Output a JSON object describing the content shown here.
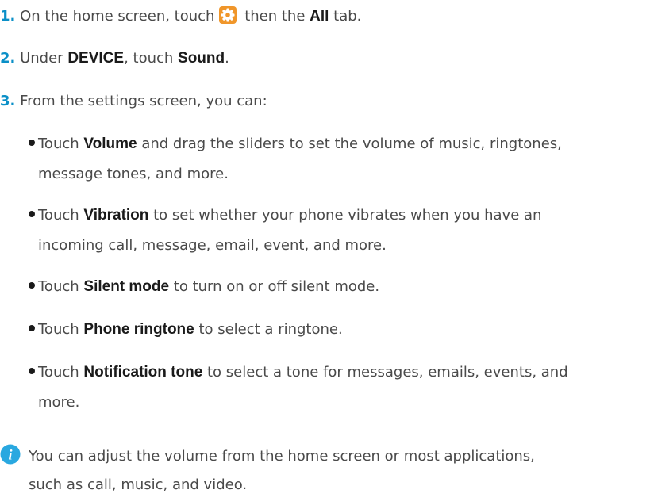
{
  "step1": {
    "num": "1.",
    "text_before": " On the home screen, touch",
    "text_middle": " then the ",
    "bold": "All",
    "text_after": " tab.",
    "icon": "settings-gear-icon"
  },
  "step2": {
    "num": "2.",
    "text_before": " Under ",
    "bold1": "DEVICE",
    "text_middle": ", touch ",
    "bold2": "Sound",
    "text_after": "."
  },
  "step3": {
    "num": "3.",
    "text": " From the settings screen, you can:"
  },
  "bullets": [
    {
      "prefix": "Touch ",
      "bold": "Volume",
      "line1": " and drag the sliders to set the volume of music, ringtones,",
      "line2": "message tones, and more."
    },
    {
      "prefix": "Touch ",
      "bold": "Vibration",
      "line1": " to set whether your phone vibrates when you have an",
      "line2": "incoming call, message, email, event, and more."
    },
    {
      "prefix": "Touch ",
      "bold": "Silent mode",
      "line1": " to turn on or off silent mode."
    },
    {
      "prefix": "Touch ",
      "bold": "Phone ringtone",
      "line1": " to select a ringtone."
    },
    {
      "prefix": "Touch ",
      "bold": "Notification tone",
      "line1": " to select a tone for messages, emails, events, and",
      "line2": "more."
    }
  ],
  "note": {
    "icon": "info-icon",
    "line1": "You can adjust the volume from the home screen or most applications,",
    "line2": "such as call, music, and video."
  },
  "colors": {
    "step_number": "#0a8fc7",
    "body_text": "#4a4a4a",
    "bold_text": "#1a1a1a",
    "info_icon": "#29a8e0",
    "settings_icon": "#f0962a"
  }
}
